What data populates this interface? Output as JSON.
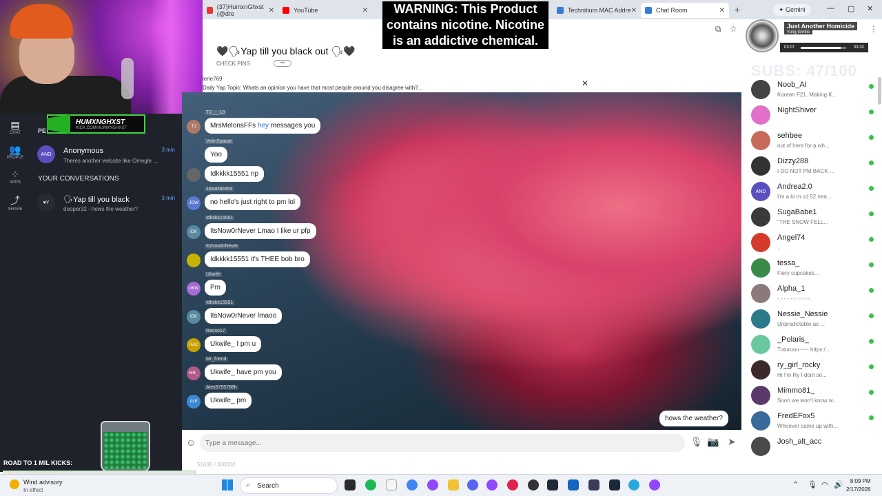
{
  "browser": {
    "tabs": [
      {
        "label": "(37)HumxnGhxst (@dre",
        "icon_color": "#e33"
      },
      {
        "label": "YouTube",
        "icon_color": "#f00"
      },
      {
        "label": "Technitium MAC Addre",
        "icon_color": "#3a7bd5"
      },
      {
        "label": "Chat Room",
        "icon_color": "#3a7bd5"
      }
    ],
    "gemini_label": "Gemini"
  },
  "warning": {
    "line1": "WARNING: This Product",
    "line2": "contains nicotine. Nicotine",
    "line3": "is an addictive chemical."
  },
  "player": {
    "title": "Just Another Homicide",
    "artist": "Yung Grmlie",
    "elapsed": "03:07",
    "duration": "03:32",
    "progress": 0.88
  },
  "subs_goal": "SUBS: 47/100",
  "banner": {
    "name": "HUMXNGHXST",
    "sub": "KICK.COM/HUMXNGHXST"
  },
  "nav": {
    "chat": "CHAT",
    "people": "PEOPLE",
    "apps": "APPS",
    "share": "SHARE"
  },
  "left": {
    "pe_label": "PE",
    "anon": {
      "avatar": "ANO",
      "name": "Anonymous",
      "preview": "Theres another website like Omegle ...",
      "time": "3 min"
    },
    "section_title": "YOUR CONVERSATIONS",
    "yap": {
      "avatar": "♥Y",
      "name": "🗣Yap till you black",
      "preview": "dooper32 - hows the weather?",
      "time": "3 min"
    },
    "road_label": "ROAD TO 1 MIL KICKS:",
    "road_progress": 0.01,
    "road_value": "51636 / 300000"
  },
  "room": {
    "title": "🖤🗣Yap till you black out 🗣🖤",
    "check_pins": "CHECK PINS",
    "pins_btn": "•••",
    "topic_user": "lerie769",
    "topic_text": "Daily Yap Topic: Whats an opinion you have that most people around you disagree with?..."
  },
  "messages": [
    {
      "user": "TJ___10",
      "avatar": "TJ",
      "color": "#b07a6a",
      "text_pre": "MrsMelonsFFs ",
      "text_hl": "hey",
      "text_post": " messages you"
    },
    {
      "user": "VolinSpavat",
      "avatar": "",
      "color": "#ddd",
      "text_pre": "Yoo",
      "text_hl": "",
      "text_post": ""
    },
    {
      "user": "",
      "avatar": "",
      "color": "#666",
      "text_pre": "Idkkkk15551 np",
      "text_hl": "",
      "text_post": ""
    },
    {
      "user": "JowaNice54",
      "avatar": "JOW",
      "color": "#5a7bd4",
      "text_pre": "no hello's just right to pm lol",
      "text_hl": "",
      "text_post": ""
    },
    {
      "user": "Idkkkk15551",
      "avatar": "IDK",
      "color": "#5a8aa0",
      "text_pre": "ItsNow0rNever Lmao I like ur pfp",
      "text_hl": "",
      "text_post": ""
    },
    {
      "user": "ItsNow0rNever",
      "avatar": "",
      "color": "#c8b400",
      "text_pre": "Idkkkk15551 it's THEE bob bro",
      "text_hl": "",
      "text_post": ""
    },
    {
      "user": "Ukwife",
      "avatar": "UKW",
      "color": "#a86bd4",
      "text_pre": "Pm",
      "text_hl": "",
      "text_post": ""
    },
    {
      "user": "Idkkkk15551",
      "avatar": "IDK",
      "color": "#5a8aa0",
      "text_pre": "ItsNow0rNever lmaoo",
      "text_hl": "",
      "text_post": ""
    },
    {
      "user": "Racso17",
      "avatar": "RAC",
      "color": "#c8a000",
      "text_pre": "Ukwife_ I pm u",
      "text_hl": "",
      "text_post": ""
    },
    {
      "user": "Mr_friend",
      "avatar": "MR_",
      "color": "#b05a8a",
      "text_pre": "Ukwife_ have pm you",
      "text_hl": "",
      "text_post": ""
    },
    {
      "user": "Alex5755788h",
      "avatar": "ALE",
      "color": "#3a8ad4",
      "text_pre": "Ukwife_ pm",
      "text_hl": "",
      "text_post": ""
    }
  ],
  "my_message": "hows the weather?",
  "input": {
    "placeholder": "Type a message..."
  },
  "users": [
    {
      "name": "Noob_AI",
      "status": "Korean F21. Making K...",
      "avatar": "",
      "color": "#444"
    },
    {
      "name": "NightShiver",
      "status": "",
      "avatar": "",
      "color": "#e070c8"
    },
    {
      "name": "sehbee",
      "status": "out of here for a wh...",
      "avatar": "",
      "color": "#c86a5a"
    },
    {
      "name": "Dizzy288",
      "status": "I DO NOT PM BACK ...",
      "avatar": "",
      "color": "#333"
    },
    {
      "name": "Andrea2.0",
      "status": "I'm a bi m cd 52 nea...",
      "avatar": "AND",
      "color": "#5a4fbf"
    },
    {
      "name": "SugaBabe1",
      "status": "\"THE SNOW FELL...",
      "avatar": "",
      "color": "#3a3a3a"
    },
    {
      "name": "Angel74",
      "status": "..",
      "avatar": "",
      "color": "#d43a2a"
    },
    {
      "name": "tessa_",
      "status": "Fiery cupcakes...",
      "avatar": "",
      "color": "#3a8a4a"
    },
    {
      "name": "Alpha_1",
      "status": "-.-.-.-.-.-.-.-.-.-..",
      "avatar": "",
      "color": "#8a7a7a"
    },
    {
      "name": "Nessie_Nessie",
      "status": "Unpredictable as ...",
      "avatar": "",
      "color": "#2a7a8a"
    },
    {
      "name": "_Polaris_",
      "status": "Tuturuuu~~~ https:/...",
      "avatar": "",
      "color": "#6ac8a0"
    },
    {
      "name": "ry_girl_rocky",
      "status": "Hi I'm Ry I dont se...",
      "avatar": "",
      "color": "#3a2a2a"
    },
    {
      "name": "Mimmo81_",
      "status": "Soon we won't know w...",
      "avatar": "",
      "color": "#5a3a6a"
    },
    {
      "name": "FredEFox5",
      "status": "Whoever came up with...",
      "avatar": "",
      "color": "#3a6a9a"
    },
    {
      "name": "Josh_alt_acc",
      "status": "",
      "avatar": "",
      "color": "#4a4a4a"
    }
  ],
  "taskbar": {
    "weather_title": "Wind advisory",
    "weather_sub": "In effect",
    "search": "Search",
    "time": "8:09 PM",
    "date": "2/17/2026"
  }
}
